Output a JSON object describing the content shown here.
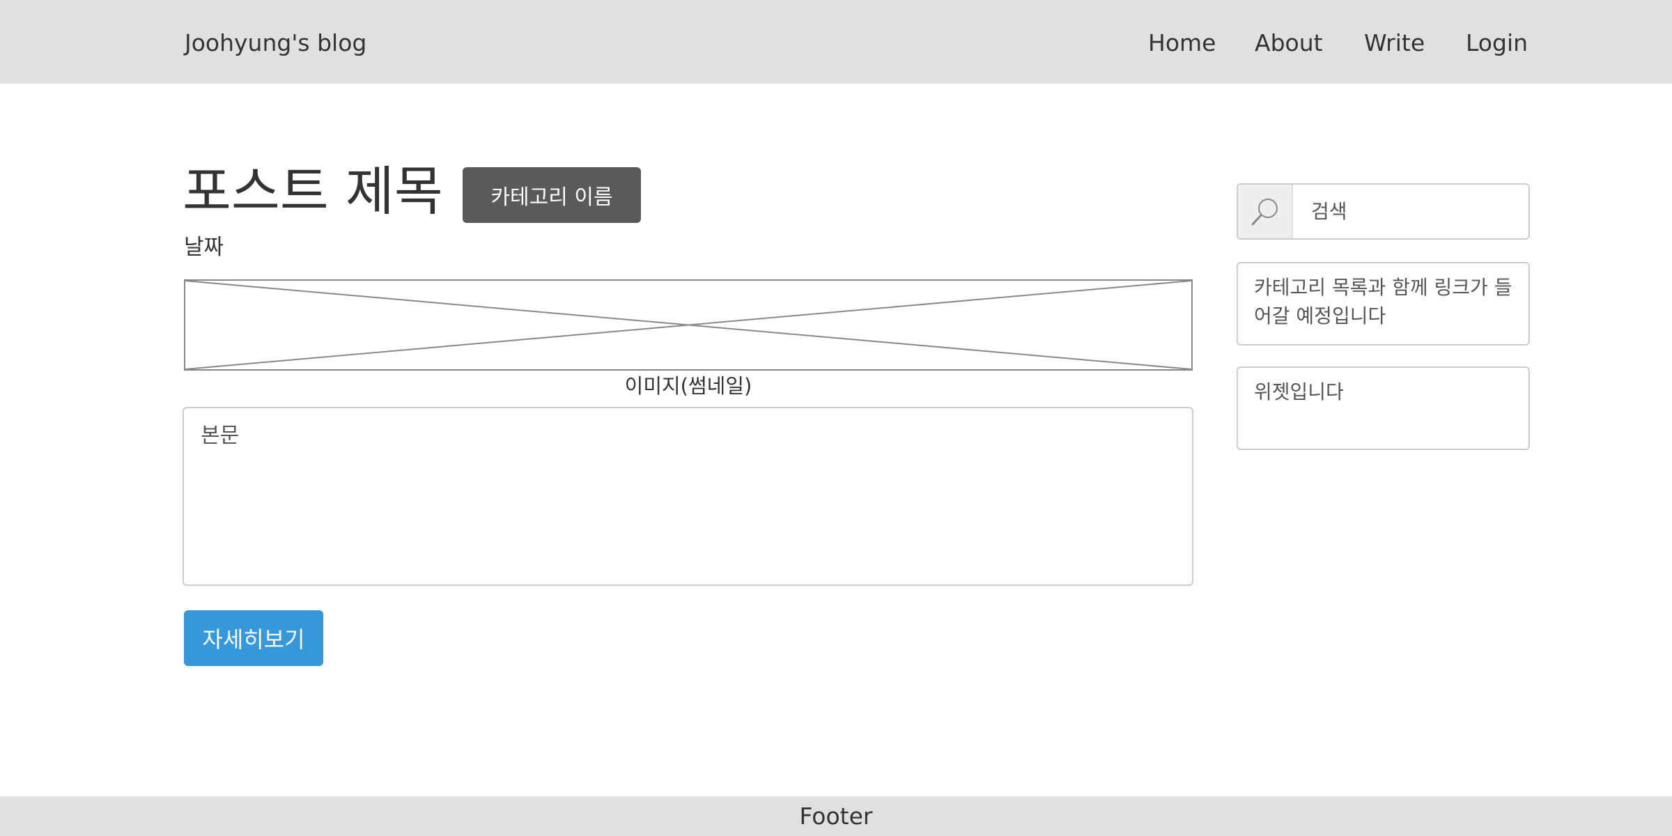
{
  "header": {
    "brand": "Joohyung's blog",
    "nav": {
      "home": "Home",
      "about": "About",
      "write": "Write",
      "login": "Login"
    },
    "background_color": "#e0e0e0"
  },
  "post": {
    "title": "포스트 제목",
    "category": "카테고리 이름",
    "date": "날짜",
    "thumbnail_caption": "이미지(썸네일)",
    "body_placeholder": "본문",
    "read_more_label": "자세히보기",
    "category_color": "#5a5a5a",
    "button_color": "#3498db"
  },
  "sidebar": {
    "search": {
      "placeholder": "검색",
      "icon": "search-icon"
    },
    "categories_widget": "카테고리 목록과 함께 링크가 들어갈 예정입니다",
    "widget": "위젯입니다"
  },
  "footer": {
    "text": "Footer"
  }
}
